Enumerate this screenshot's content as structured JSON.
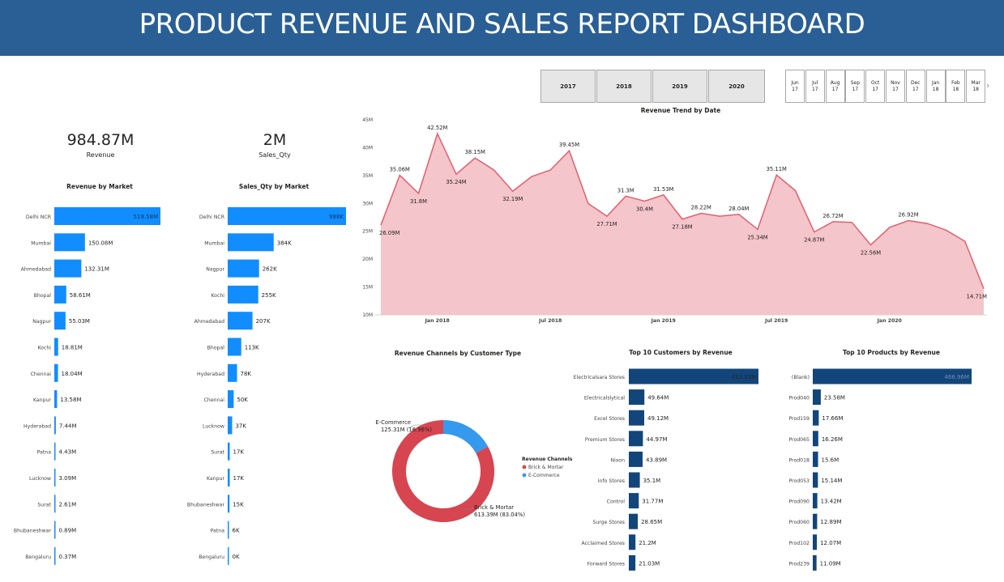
{
  "header": {
    "title": "PRODUCT REVENUE AND SALES REPORT DASHBOARD"
  },
  "kpis": {
    "revenue": {
      "value": "984.87M",
      "label": "Revenue"
    },
    "sales_qty": {
      "value": "2M",
      "label": "Sales_Qty"
    }
  },
  "year_slicer": [
    "2017",
    "2018",
    "2019",
    "2020"
  ],
  "month_slicer": [
    {
      "m": "Jun",
      "y": "17"
    },
    {
      "m": "Jul",
      "y": "17"
    },
    {
      "m": "Aug",
      "y": "17"
    },
    {
      "m": "Sep",
      "y": "17"
    },
    {
      "m": "Oct",
      "y": "17"
    },
    {
      "m": "Nov",
      "y": "17"
    },
    {
      "m": "Dec",
      "y": "17"
    },
    {
      "m": "Jan",
      "y": "18"
    },
    {
      "m": "Feb",
      "y": "18"
    },
    {
      "m": "Mar",
      "y": "18"
    }
  ],
  "colors": {
    "header": "#2a5f95",
    "bar_blue": "#118dff",
    "bar_navy": "#12467b",
    "area_line": "#e0606e",
    "area_fill": "#f4c5ca",
    "brick": "#d64550",
    "ecommerce": "#3599ee"
  },
  "chart_data": [
    {
      "type": "bar",
      "orientation": "horizontal",
      "title": "Revenue by Market",
      "categories": [
        "Delhi NCR",
        "Mumbai",
        "Ahmedabad",
        "Bhopal",
        "Nagpur",
        "Kochi",
        "Chennai",
        "Kanpur",
        "Hyderabad",
        "Patna",
        "Lucknow",
        "Surat",
        "Bhubaneshwar",
        "Bengaluru"
      ],
      "values": [
        519.58,
        150.08,
        132.31,
        58.61,
        55.03,
        18.81,
        18.04,
        13.58,
        7.44,
        4.43,
        3.09,
        2.61,
        0.89,
        0.37
      ],
      "labels": [
        "519.58M",
        "150.08M",
        "132.31M",
        "58.61M",
        "55.03M",
        "18.81M",
        "18.04M",
        "13.58M",
        "7.44M",
        "4.43M",
        "3.09M",
        "2.61M",
        "0.89M",
        "0.37M"
      ]
    },
    {
      "type": "bar",
      "orientation": "horizontal",
      "title": "Sales_Qty by Market",
      "categories": [
        "Delhi NCR",
        "Mumbai",
        "Nagpur",
        "Kochi",
        "Ahmedabad",
        "Bhopal",
        "Hyderabad",
        "Chennai",
        "Lucknow",
        "Surat",
        "Kanpur",
        "Bhubaneshwar",
        "Patna",
        "Bengaluru"
      ],
      "values": [
        988,
        384,
        262,
        255,
        207,
        113,
        78,
        50,
        37,
        17,
        17,
        15,
        6,
        0
      ],
      "labels": [
        "988K",
        "384K",
        "262K",
        "255K",
        "207K",
        "113K",
        "78K",
        "50K",
        "37K",
        "17K",
        "17K",
        "15K",
        "6K",
        "0K"
      ]
    },
    {
      "type": "area",
      "title": "Revenue Trend by Date",
      "ylim": [
        10,
        45
      ],
      "yticks": [
        "10M",
        "15M",
        "20M",
        "25M",
        "30M",
        "35M",
        "40M",
        "45M"
      ],
      "xticks": [
        "Jan 2018",
        "Jul 2018",
        "Jan 2019",
        "Jul 2019",
        "Jan 2020"
      ],
      "x": [
        "2017-10",
        "2017-11",
        "2017-12",
        "2018-01",
        "2018-02",
        "2018-03",
        "2018-04",
        "2018-05",
        "2018-06",
        "2018-07",
        "2018-08",
        "2018-09",
        "2018-10",
        "2018-11",
        "2018-12",
        "2019-01",
        "2019-02",
        "2019-03",
        "2019-04",
        "2019-05",
        "2019-06",
        "2019-07",
        "2019-08",
        "2019-09",
        "2019-10",
        "2019-11",
        "2019-12",
        "2020-01",
        "2020-02",
        "2020-03",
        "2020-04",
        "2020-05",
        "2020-06"
      ],
      "values": [
        26.09,
        35.06,
        31.8,
        42.52,
        35.24,
        38.15,
        36.0,
        32.19,
        34.8,
        36.0,
        39.45,
        30.0,
        27.71,
        31.3,
        30.4,
        31.53,
        27.18,
        28.22,
        27.7,
        28.04,
        25.34,
        35.11,
        32.3,
        24.87,
        26.72,
        26.6,
        22.56,
        25.7,
        26.92,
        26.4,
        25.2,
        23.2,
        14.71
      ],
      "point_labels": [
        "26.09M",
        "35.06M",
        "31.8M",
        "42.52M",
        "35.24M",
        "38.15M",
        "",
        "32.19M",
        "",
        "",
        "39.45M",
        "",
        "27.71M",
        "31.3M",
        "30.4M",
        "31.53M",
        "27.18M",
        "28.22M",
        "",
        "28.04M",
        "25.34M",
        "35.11M",
        "",
        "24.87M",
        "26.72M",
        "",
        "22.56M",
        "",
        "26.92M",
        "",
        "",
        "",
        "14.71M"
      ]
    },
    {
      "type": "pie",
      "title": "Revenue Channels by Customer Type",
      "legend_title": "Revenue Channels",
      "legend_position": "right",
      "categories": [
        "Brick & Mortar",
        "E-Commerce"
      ],
      "legend_labels": [
        "Brick & Mortar",
        "E-Commerce"
      ],
      "values": [
        613.39,
        125.31
      ],
      "labels": [
        [
          "Brick & Mortar",
          "613.39M (83.04%)"
        ],
        [
          "E-Commerce",
          "125.31M (16.96%)"
        ]
      ]
    },
    {
      "type": "bar",
      "orientation": "horizontal",
      "title": "Top 10 Customers by Revenue",
      "categories": [
        "Electricalsara Stores",
        "Electricalslytical",
        "Excel Stores",
        "Premium Stores",
        "Nixon",
        "Info Stores",
        "Control",
        "Surge Stores",
        "Acclaimed Stores",
        "Forward Stores"
      ],
      "values": [
        413.33,
        49.64,
        49.12,
        44.97,
        43.89,
        35.1,
        31.77,
        28.65,
        21.2,
        21.03
      ],
      "labels": [
        "413.33M",
        "49.64M",
        "49.12M",
        "44.97M",
        "43.89M",
        "35.1M",
        "31.77M",
        "28.65M",
        "21.2M",
        "21.03M"
      ]
    },
    {
      "type": "bar",
      "orientation": "horizontal",
      "title": "Top 10 Products by Revenue",
      "categories": [
        "(Blank)",
        "Prod040",
        "Prod159",
        "Prod065",
        "Prod018",
        "Prod053",
        "Prod090",
        "Prod060",
        "Prod102",
        "Prod239"
      ],
      "values": [
        466.96,
        23.58,
        17.66,
        16.26,
        15.6,
        15.14,
        13.42,
        12.89,
        12.07,
        11.09
      ],
      "labels": [
        "466.96M",
        "23.58M",
        "17.66M",
        "16.26M",
        "15.6M",
        "15.14M",
        "13.42M",
        "12.89M",
        "12.07M",
        "11.09M"
      ]
    }
  ]
}
